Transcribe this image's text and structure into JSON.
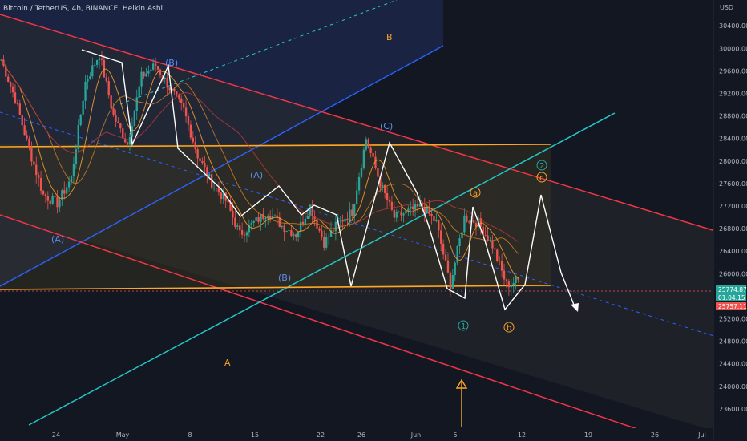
{
  "header": {
    "symbol_line": "Bitcoin / TetherUS, 4h, BINANCE, Heikin Ashi",
    "currency": "USD"
  },
  "price_badges": [
    {
      "value": "25774.87",
      "color": "#26a69a"
    },
    {
      "value": "01:04:15",
      "color": "#26a69a"
    },
    {
      "value": "25757.11",
      "color": "#ef5350"
    }
  ],
  "colors": {
    "background": "#131722",
    "bull": "#26a69a",
    "bear": "#ef5350",
    "channel_red": "#f23645",
    "channel_blue": "#2962ff",
    "teal_line": "#22c7c7",
    "orange_level": "#ffa726",
    "wave_label_blue": "#5b8def",
    "wave_label_orange": "#f7a02b",
    "axis_text": "#b2b5be"
  },
  "chart_data": {
    "type": "candlestick",
    "title": "Bitcoin / TetherUS, 4h, BINANCE, Heikin Ashi",
    "y_axis": {
      "position": "right",
      "ylim": [
        23400,
        31000
      ],
      "ticks": [
        30400,
        30000,
        29600,
        29200,
        28800,
        28400,
        28000,
        27600,
        27200,
        26800,
        26400,
        26000,
        25200,
        24800,
        24400,
        24000,
        23600
      ]
    },
    "x_axis": {
      "ticks": [
        "24",
        "May",
        "8",
        "15",
        "22",
        "26",
        "Jun",
        "5",
        "12",
        "19",
        "26",
        "Jul"
      ]
    },
    "price_path": [
      [
        "24",
        29800
      ],
      [
        "24",
        29100
      ],
      [
        "24",
        28200
      ],
      [
        "24",
        27400
      ],
      [
        "24",
        27250
      ],
      [
        "24",
        27700
      ],
      [
        "May",
        29400
      ],
      [
        "May",
        29900
      ],
      [
        "May",
        28800
      ],
      [
        "May",
        28300
      ],
      [
        "May",
        29500
      ],
      [
        "May",
        29700
      ],
      [
        "May",
        29300
      ],
      [
        "8",
        28900
      ],
      [
        "8",
        28100
      ],
      [
        "8",
        27600
      ],
      [
        "8",
        27300
      ],
      [
        "15",
        26700
      ],
      [
        "15",
        26900
      ],
      [
        "15",
        27100
      ],
      [
        "22",
        26850
      ],
      [
        "22",
        26700
      ],
      [
        "22",
        27200
      ],
      [
        "22",
        26550
      ],
      [
        "26",
        26900
      ],
      [
        "26",
        27100
      ],
      [
        "26",
        28400
      ],
      [
        "26",
        27600
      ],
      [
        "Jun",
        27000
      ],
      [
        "Jun",
        27100
      ],
      [
        "Jun",
        27200
      ],
      [
        "5",
        26900
      ],
      [
        "5",
        25800
      ],
      [
        "5",
        27000
      ],
      [
        "5",
        26900
      ],
      [
        "12",
        26500
      ],
      [
        "12",
        25800
      ],
      [
        "12",
        25900
      ]
    ],
    "current_price": 25774.87,
    "annotations": {
      "wave_labels": [
        {
          "text": "(A)",
          "color": "blue"
        },
        {
          "text": "(B)",
          "color": "blue"
        },
        {
          "text": "(A)",
          "color": "blue"
        },
        {
          "text": "(B)",
          "color": "blue"
        },
        {
          "text": "(C)",
          "color": "blue"
        },
        {
          "text": "a",
          "color": "orange"
        },
        {
          "text": "b",
          "color": "orange"
        },
        {
          "text": "c",
          "color": "orange"
        },
        {
          "text": "1",
          "color": "teal"
        },
        {
          "text": "2",
          "color": "teal"
        },
        {
          "text": "A",
          "color": "orange"
        },
        {
          "text": "B",
          "color": "orange"
        }
      ],
      "horizontal_levels": [
        28450,
        26000
      ],
      "channels": [
        "red descending channel",
        "blue ascending channel",
        "teal trend line"
      ]
    }
  }
}
